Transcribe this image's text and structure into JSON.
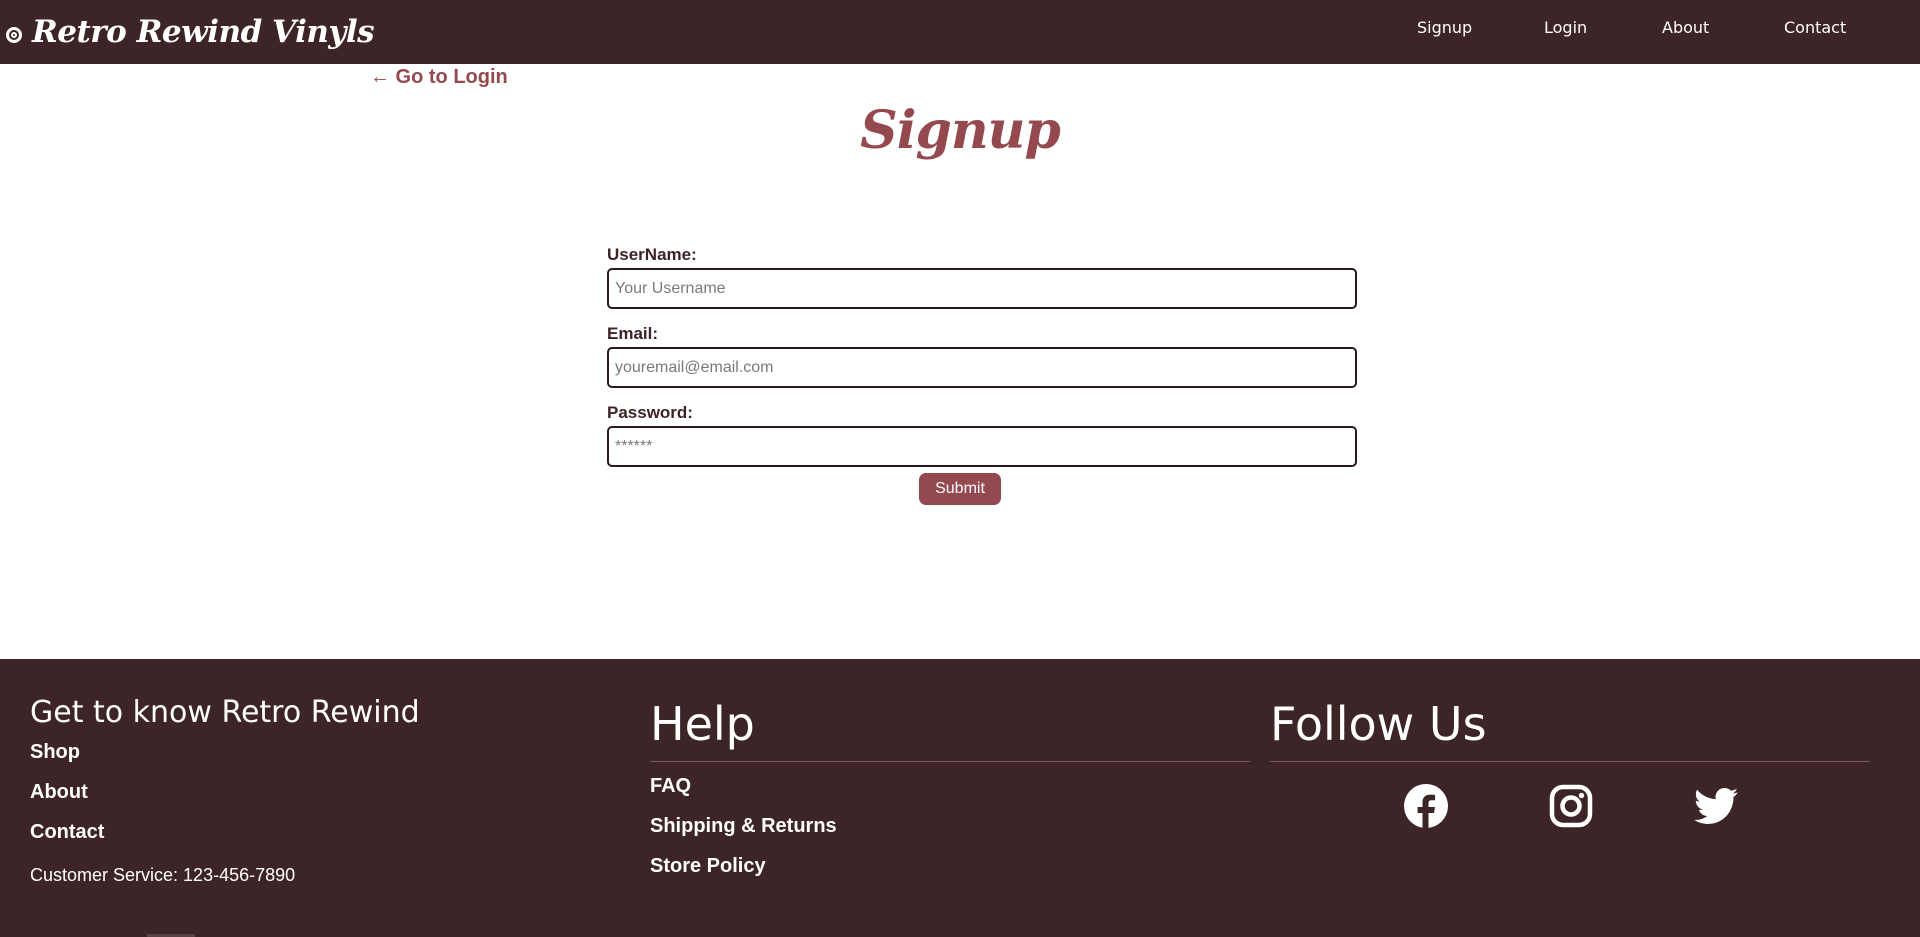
{
  "navbar": {
    "brand": "Retro Rewind Vinyls",
    "brand_icon": "vinyl-record-icon",
    "links": [
      "Signup",
      "Login",
      "About",
      "Contact"
    ]
  },
  "main": {
    "back_link": "← Go to Login",
    "title": "Signup",
    "form": {
      "username_label": "UserName:",
      "username_placeholder": "Your Username",
      "email_label": "Email:",
      "email_placeholder": "youremail@email.com",
      "password_label": "Password:",
      "password_placeholder": "******",
      "submit_label": "Submit"
    }
  },
  "footer": {
    "col1": {
      "heading": "Get to know Retro Rewind",
      "links": [
        "Shop",
        "About",
        "Contact"
      ],
      "customer_service": "Customer Service: 123-456-7890"
    },
    "col2": {
      "heading": "Help",
      "links": [
        "FAQ",
        "Shipping & Returns",
        "Store Policy"
      ]
    },
    "col3": {
      "heading": "Follow Us",
      "icons": [
        "facebook-icon",
        "instagram-icon",
        "twitter-icon"
      ]
    }
  },
  "colors": {
    "nav_bg": "#3d2426",
    "accent": "#94494f",
    "text_dark": "#3c2426"
  }
}
